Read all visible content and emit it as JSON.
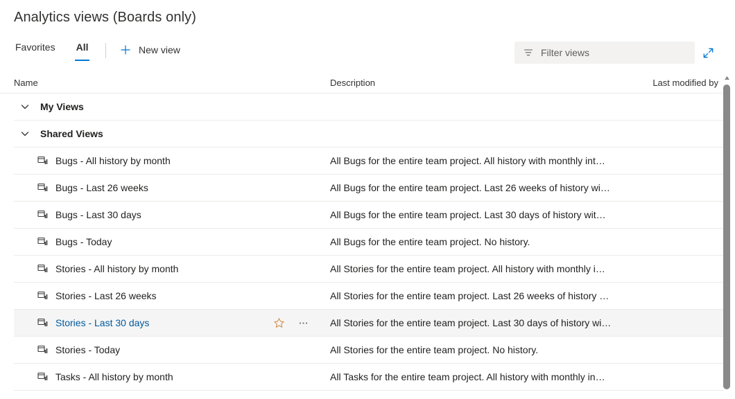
{
  "header": {
    "title": "Analytics views (Boards only)"
  },
  "commandbar": {
    "tabs": [
      {
        "label": "Favorites",
        "active": false
      },
      {
        "label": "All",
        "active": true
      }
    ],
    "new_view_label": "New view",
    "plus_icon": "plus-icon"
  },
  "search": {
    "placeholder": "Filter views",
    "value": "",
    "icon": "filter-icon"
  },
  "expand": {
    "icon": "expand-diagonal-icon",
    "color": "#0078d4"
  },
  "list": {
    "columns": {
      "name": "Name",
      "description": "Description",
      "last_modified_by": "Last modified by"
    },
    "groups": [
      {
        "label": "My Views",
        "expanded": true,
        "chevron": "chevron-down-icon",
        "items": []
      },
      {
        "label": "Shared Views",
        "expanded": true,
        "chevron": "chevron-down-icon",
        "items": [
          {
            "name": "Bugs - All history by month",
            "description": "All Bugs for the entire team project. All history with monthly int…",
            "icon": "analytics-view-icon",
            "hovered": false
          },
          {
            "name": "Bugs - Last 26 weeks",
            "description": "All Bugs for the entire team project. Last 26 weeks of history wi…",
            "icon": "analytics-view-icon",
            "hovered": false
          },
          {
            "name": "Bugs - Last 30 days",
            "description": "All Bugs for the entire team project. Last 30 days of history wit…",
            "icon": "analytics-view-icon",
            "hovered": false
          },
          {
            "name": "Bugs - Today",
            "description": "All Bugs for the entire team project. No history.",
            "icon": "analytics-view-icon",
            "hovered": false
          },
          {
            "name": "Stories - All history by month",
            "description": "All Stories for the entire team project. All history with monthly i…",
            "icon": "analytics-view-icon",
            "hovered": false
          },
          {
            "name": "Stories - Last 26 weeks",
            "description": "All Stories for the entire team project. Last 26 weeks of history …",
            "icon": "analytics-view-icon",
            "hovered": false
          },
          {
            "name": "Stories - Last 30 days",
            "description": "All Stories for the entire team project. Last 30 days of history wi…",
            "icon": "analytics-view-icon",
            "hovered": true,
            "actions": {
              "favorite_icon": "star-outline-icon",
              "more_icon": "ellipsis-icon"
            }
          },
          {
            "name": "Stories - Today",
            "description": "All Stories for the entire team project. No history.",
            "icon": "analytics-view-icon",
            "hovered": false
          },
          {
            "name": "Tasks - All history by month",
            "description": "All Tasks for the entire team project. All history with monthly in…",
            "icon": "analytics-view-icon",
            "hovered": false
          }
        ]
      }
    ]
  },
  "scrollbar": {
    "up_arrow_icon": "caret-up-icon",
    "thumb_color": "#898989"
  }
}
